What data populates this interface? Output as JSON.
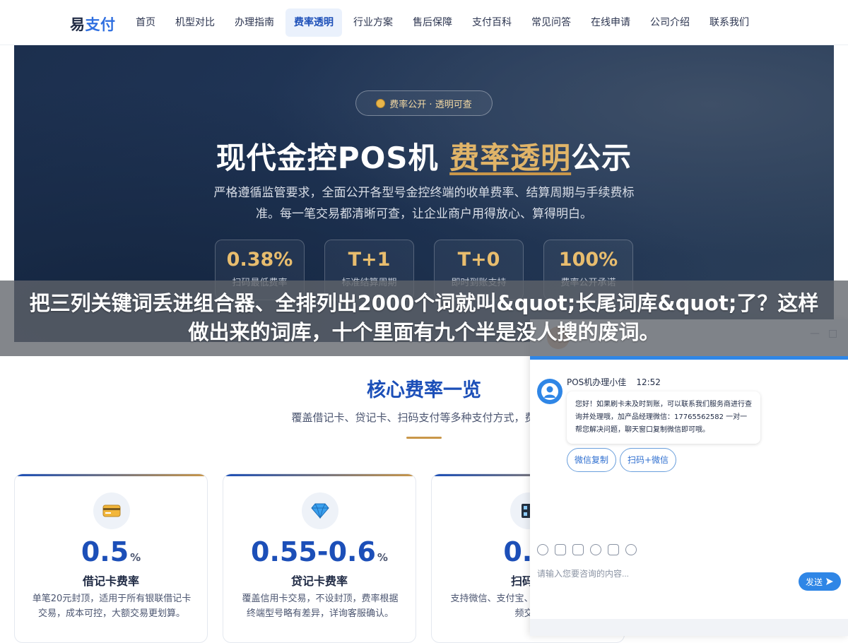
{
  "logo": {
    "part1": "易",
    "part2": "支付"
  },
  "nav": {
    "items": [
      {
        "label": "首页"
      },
      {
        "label": "机型对比"
      },
      {
        "label": "办理指南"
      },
      {
        "label": "费率透明"
      },
      {
        "label": "行业方案"
      },
      {
        "label": "售后保障"
      },
      {
        "label": "支付百科"
      },
      {
        "label": "常见问答"
      },
      {
        "label": "在线申请"
      },
      {
        "label": "公司介绍"
      },
      {
        "label": "联系我们"
      }
    ],
    "active_index": 3
  },
  "hero": {
    "badge": "费率公开 · 透明可查",
    "title_a": "现代金控POS机 ",
    "title_highlight": "费率透明",
    "title_b": "公示",
    "desc": "严格遵循监管要求，全面公开各型号金控终端的收单费率、结算周期与手续费标准。每一笔交易都清晰可查，让企业商户用得放心、算得明白。",
    "stats": [
      {
        "value": "0.38%",
        "label": "扫码最低费率"
      },
      {
        "value": "T+1",
        "label": "标准结算周期"
      },
      {
        "value": "T+0",
        "label": "即时到账支持"
      },
      {
        "value": "100%",
        "label": "费率公开承诺"
      }
    ]
  },
  "banner": {
    "text": "把三列关键词丢进组合器、全排列出2000个词就叫&quot;长尾词库&quot;了？这样做出来的词库，十个里面有九个半是没人搜的废词。"
  },
  "section": {
    "title": "核心费率一览",
    "subtitle": "覆盖借记卡、贷记卡、扫码支付等多种支付方式，费率标"
  },
  "cards": [
    {
      "num": "0.5",
      "unit": "%",
      "title": "借记卡费率",
      "desc": "单笔20元封顶，适用于所有银联借记卡交易，成本可控，大额交易更划算。"
    },
    {
      "num": "0.55-0.6",
      "unit": "%",
      "title": "贷记卡费率",
      "desc": "覆盖信用卡交易，不设封顶，费率根据终端型号略有差异，详询客服确认。"
    },
    {
      "num": "0.3",
      "unit": "",
      "title": "扫码支",
      "desc": "支持微信、支付宝、流扫码方式，费率频交易"
    }
  ],
  "chat": {
    "agent_name": "POS机办理小佳",
    "time": "12:52",
    "message": "您好！如果刷卡未及时到账，可以联系我们服务商进行查询并处理哦，加产品经理微信：17765562582 一对一帮您解决问题，聊天窗口复制微信即可哦。",
    "quick_reply_1": "微信复制",
    "quick_reply_2": "扫码+微信",
    "input_placeholder": "请输入您要咨询的内容...",
    "send_label": "发送",
    "minimize_glyph": "—",
    "maximize_glyph": "□"
  },
  "colors": {
    "brand_blue": "#1c4fb8",
    "gold": "#c9974a",
    "chat_blue": "#2f86e6"
  }
}
